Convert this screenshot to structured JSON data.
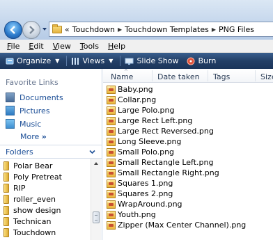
{
  "address": {
    "overflow": "«",
    "crumbs": [
      "Touchdown",
      "Touchdown Templates",
      "PNG Files"
    ]
  },
  "menu": [
    "File",
    "Edit",
    "View",
    "Tools",
    "Help"
  ],
  "menu_mnemonics": [
    "F",
    "E",
    "V",
    "T",
    "H"
  ],
  "toolbar": {
    "organize": "Organize",
    "views": "Views",
    "slideshow": "Slide Show",
    "burn": "Burn"
  },
  "left": {
    "favorites_heading": "Favorite Links",
    "favorites": [
      "Documents",
      "Pictures",
      "Music"
    ],
    "more": "More",
    "more_glyph": "»",
    "folders_heading": "Folders",
    "tree": [
      "Polar Bear",
      "Poly Pretreat",
      "RIP",
      "roller_even",
      "show design",
      "Technican",
      "Touchdown"
    ]
  },
  "columns": [
    "Name",
    "Date taken",
    "Tags",
    "Size"
  ],
  "files": [
    "Baby.png",
    "Collar.png",
    "Large Polo.png",
    "Large Rect Left.png",
    "Large Rect Reversed.png",
    "Long Sleeve.png",
    "Small Polo.png",
    "Small Rectangle Left.png",
    "Small Rectangle Right.png",
    "Squares 1.png",
    "Squares 2.png",
    "WrapAround.png",
    "Youth.png",
    "Zipper (Max Center Channel).png"
  ],
  "colors": {
    "toolbar": "#233f66",
    "link": "#1a4d96",
    "addressbar": "#c4d6ec"
  }
}
